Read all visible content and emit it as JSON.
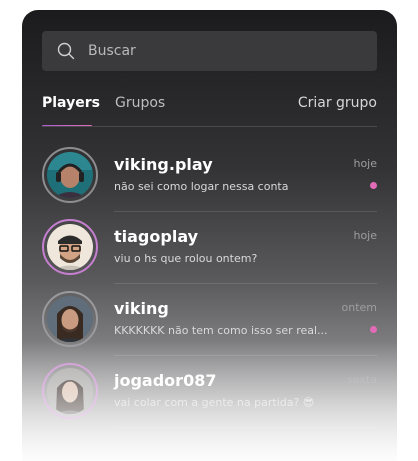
{
  "search": {
    "placeholder": "Buscar"
  },
  "tabs": {
    "players": "Players",
    "groups": "Grupos",
    "create_group": "Criar grupo"
  },
  "colors": {
    "accent_gradient_start": "#b05cd6",
    "accent_gradient_end": "#e06fb5",
    "unread_dot": "#e26bb8"
  },
  "conversations": [
    {
      "name": "viking.play",
      "message": "não sei como logar nessa conta",
      "time": "hoje",
      "unread": true,
      "avatar_icon": "gamer-headset-avatar"
    },
    {
      "name": "tiagoplay",
      "message": "viu o hs que rolou ontem?",
      "time": "hoje",
      "unread": false,
      "avatar_icon": "glasses-bearded-avatar"
    },
    {
      "name": "viking",
      "message": "KKKKKKK não tem como isso ser real...",
      "time": "ontem",
      "unread": true,
      "avatar_icon": "long-hair-avatar"
    },
    {
      "name": "jogador087",
      "message": "vai colar com a gente na partida? 😎",
      "time": "sexta",
      "unread": false,
      "avatar_icon": "woman-avatar"
    }
  ]
}
